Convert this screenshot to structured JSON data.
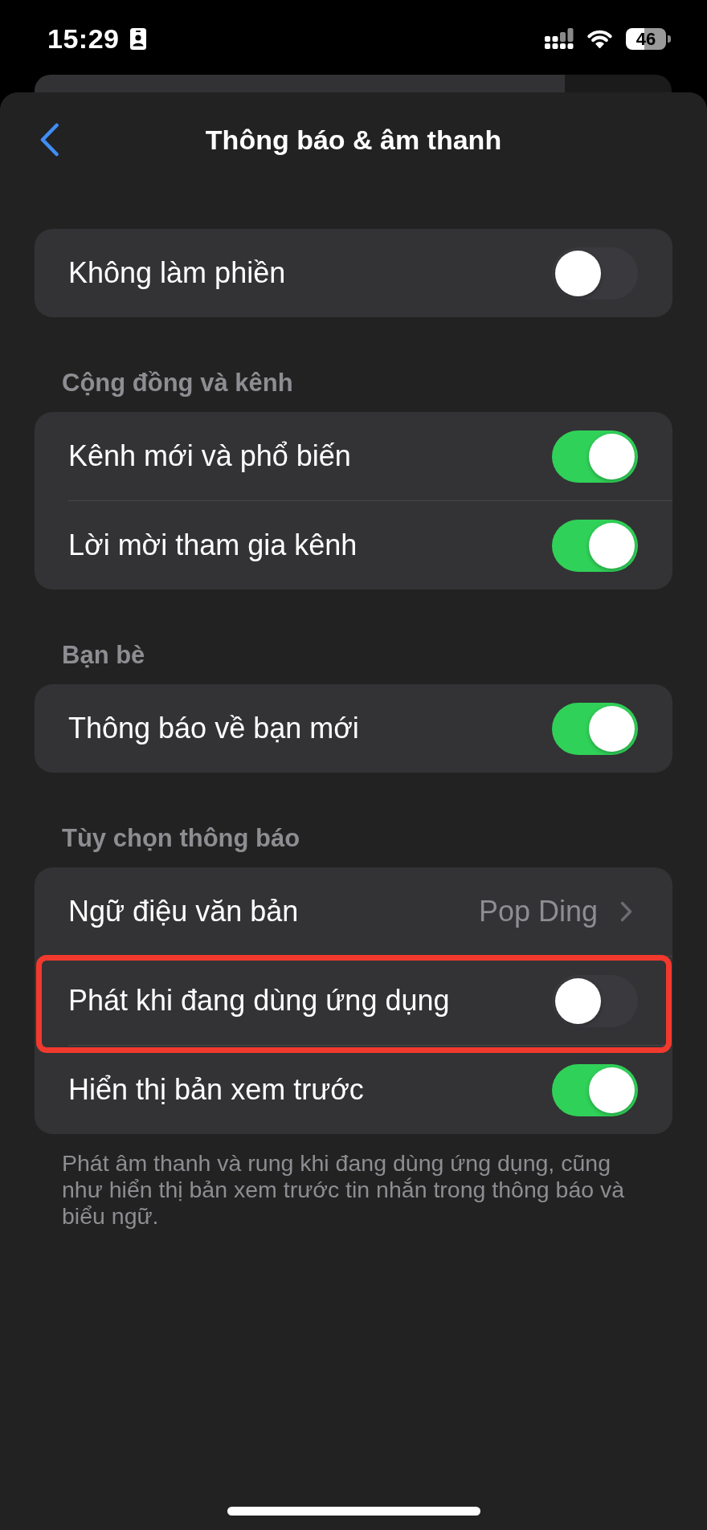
{
  "status_bar": {
    "time": "15:29",
    "battery": "46"
  },
  "navigation": {
    "title": "Thông báo & âm thanh"
  },
  "sections": [
    {
      "rows": [
        {
          "kind": "toggle",
          "label": "Không làm phiền",
          "on": false,
          "highlighted": false
        }
      ]
    },
    {
      "header": "Cộng đồng và kênh",
      "rows": [
        {
          "kind": "toggle",
          "label": "Kênh mới và phổ biến",
          "on": true,
          "highlighted": false
        },
        {
          "kind": "toggle",
          "label": "Lời mời tham gia kênh",
          "on": true,
          "highlighted": false
        }
      ]
    },
    {
      "header": "Bạn bè",
      "rows": [
        {
          "kind": "toggle",
          "label": "Thông báo về bạn mới",
          "on": true,
          "highlighted": false
        }
      ]
    },
    {
      "header": "Tùy chọn thông báo",
      "rows": [
        {
          "kind": "value",
          "label": "Ngữ điệu văn bản",
          "value": "Pop Ding",
          "highlighted": false
        },
        {
          "kind": "toggle",
          "label": "Phát khi đang dùng ứng dụng",
          "on": false,
          "highlighted": true
        },
        {
          "kind": "toggle",
          "label": "Hiển thị bản xem trước",
          "on": true,
          "highlighted": false
        }
      ],
      "footer": "Phát âm thanh và rung khi đang dùng ứng dụng, cũng như hiển thị bản xem trước tin nhắn trong thông báo và biểu ngữ."
    }
  ]
}
